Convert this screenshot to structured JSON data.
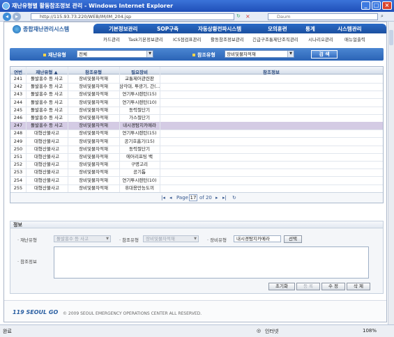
{
  "window": {
    "title": "재난유형별 활동참조정보 관리 - Windows Internet Explorer",
    "url": "http://115.93.73.220/WEB/IM/IM_204.jsp",
    "search_placeholder": "Daum",
    "min": "_",
    "max": "□",
    "close": "×"
  },
  "app": {
    "logo": "종합재난관리시스템"
  },
  "nav": [
    "기본정보관리",
    "SOP구축",
    "자동상황전파시스템",
    "모의훈련",
    "통계",
    "시스템관리"
  ],
  "subnav": [
    "카드관리",
    "Task기본정보관리",
    "ICS점검표관리",
    "활동참조정보관리",
    "긴급구조통제단조직관리",
    "시나리오관리",
    "매뉴얼출력"
  ],
  "filter": {
    "disaster_label": "재난유형",
    "disaster_value": "전체",
    "ref_label": "참조유형",
    "ref_value": "장비및물자적재",
    "search_btn": "검 색"
  },
  "grid": {
    "headers": [
      "연번",
      "재난유형 ▲",
      "참조유형",
      "필요장비",
      "참조정보"
    ],
    "rows": [
      [
        "241",
        "돌발홍수 등 사고",
        "장비및물자적재",
        "교통제어관련판"
      ],
      [
        "242",
        "돌발홍수 등 사고",
        "장비및물자적재",
        "삼각대, 투광기, 간(...)"
      ],
      [
        "243",
        "돌발홍수 등 사고",
        "장비및물자적재",
        "연기투시랜턴(15)"
      ],
      [
        "244",
        "돌발홍수 등 사고",
        "장비및물자적재",
        "연기투시랜턴(10)"
      ],
      [
        "245",
        "돌발홍수 등 사고",
        "장비및물자적재",
        "동력절단기"
      ],
      [
        "246",
        "돌발홍수 등 사고",
        "장비및물자적재",
        "가스절단기"
      ],
      [
        "247",
        "돌발홍수 등 사고",
        "장비및물자적재",
        "내시경탐지카메라"
      ],
      [
        "248",
        "대형산불사고",
        "장비및물자적재",
        "연기투시랜턴(15)"
      ],
      [
        "249",
        "대형산불사고",
        "장비및물자적재",
        "공기호흡기(15)"
      ],
      [
        "250",
        "대형산불사고",
        "장비및물자적재",
        "동력절단기"
      ],
      [
        "251",
        "대형산불사고",
        "장비및물자적재",
        "에어리프팅 백"
      ],
      [
        "252",
        "대형산불사고",
        "장비및물자적재",
        "구명고리"
      ],
      [
        "253",
        "대형산불사고",
        "장비및물자적재",
        "공기톱"
      ],
      [
        "254",
        "대형산불사고",
        "장비및물자적재",
        "연기투시랜턴(10)"
      ],
      [
        "255",
        "대형산불사고",
        "장비및물자적재",
        "휴대용만능도끼"
      ]
    ],
    "selected_index": 6
  },
  "pager": {
    "first": "|◂",
    "prev": "◂",
    "page_word": "Page",
    "current": "17",
    "of": "of 20",
    "next": "▸",
    "last": "▸|",
    "refresh": "↻"
  },
  "info": {
    "title": "정보",
    "disaster_label": "재난유형",
    "disaster_value": "돌발홍수 등 사고",
    "ref_label": "참조유형",
    "ref_value": "장비및물자적재",
    "equip_label": "장비유형",
    "equip_value": "내시경탐지카메라",
    "select_btn": "선택",
    "memo_label": "참조정보",
    "btn_reset": "초기화",
    "btn_add": "등 록",
    "btn_edit": "수 정",
    "btn_delete": "삭 제"
  },
  "footer": {
    "logo": "119 SEOUL GO",
    "copyright": "© 2009 SEOUL EMERGENCY OPERATIONS CENTER ALL RESERVED."
  },
  "status": {
    "left": "완료",
    "zone": "인터넷",
    "zoom": "108%"
  }
}
